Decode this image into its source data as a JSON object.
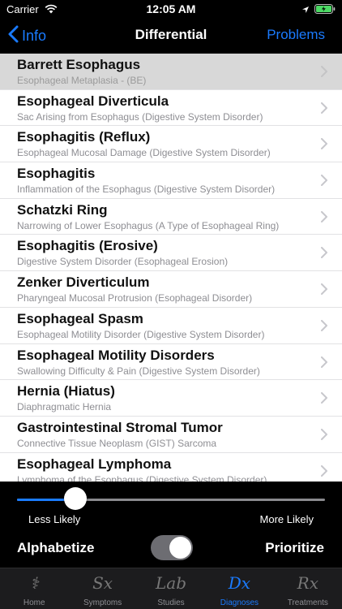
{
  "status": {
    "carrier": "Carrier",
    "time": "12:05 AM"
  },
  "nav": {
    "back_label": "Info",
    "title": "Differential",
    "right_label": "Problems"
  },
  "rows": [
    {
      "title": "Barrett Esophagus",
      "subtitle": "Esophageal Metaplasia  - (BE)",
      "selected": true
    },
    {
      "title": "Esophageal Diverticula",
      "subtitle": "Sac Arising from Esophagus (Digestive System Disorder)"
    },
    {
      "title": "Esophagitis (Reflux)",
      "subtitle": "Esophageal Mucosal Damage (Digestive System Disorder)"
    },
    {
      "title": "Esophagitis",
      "subtitle": "Inflammation of the Esophagus (Digestive System Disorder)"
    },
    {
      "title": "Schatzki Ring",
      "subtitle": "Narrowing of Lower Esophagus (A Type of Esophageal Ring)"
    },
    {
      "title": "Esophagitis (Erosive)",
      "subtitle": "Digestive System Disorder (Esophageal Erosion)"
    },
    {
      "title": "Zenker Diverticulum",
      "subtitle": "Pharyngeal Mucosal Protrusion (Esophageal Disorder)"
    },
    {
      "title": "Esophageal Spasm",
      "subtitle": "Esophageal Motility Disorder (Digestive System Disorder)"
    },
    {
      "title": "Esophageal Motility Disorders",
      "subtitle": "Swallowing Difficulty & Pain (Digestive System Disorder)"
    },
    {
      "title": "Hernia (Hiatus)",
      "subtitle": "Diaphragmatic Hernia"
    },
    {
      "title": "Gastrointestinal Stromal Tumor",
      "subtitle": "Connective Tissue Neoplasm (GIST) Sarcoma"
    },
    {
      "title": "Esophageal Lymphoma",
      "subtitle": "Lymphoma of the Esophagus (Digestive System Disorder)"
    }
  ],
  "likelihood": {
    "less_label": "Less Likely",
    "more_label": "More Likely",
    "value": 0.19
  },
  "sort": {
    "left_label": "Alphabetize",
    "right_label": "Prioritize",
    "toggle_on": true
  },
  "tabs": [
    {
      "label": "Home",
      "icon": "caduceus-icon",
      "glyph": "⚕"
    },
    {
      "label": "Symptoms",
      "icon": "sx-icon",
      "glyph": "Sx"
    },
    {
      "label": "Studies",
      "icon": "lab-icon",
      "glyph": "Lab"
    },
    {
      "label": "Diagnoses",
      "icon": "dx-icon",
      "glyph": "Dx",
      "active": true
    },
    {
      "label": "Treatments",
      "icon": "rx-icon",
      "glyph": "Rx"
    }
  ],
  "colors": {
    "accent": "#1a7bff",
    "background": "#000000",
    "list_bg": "#ffffff",
    "selected_row": "#d8d8d8"
  }
}
